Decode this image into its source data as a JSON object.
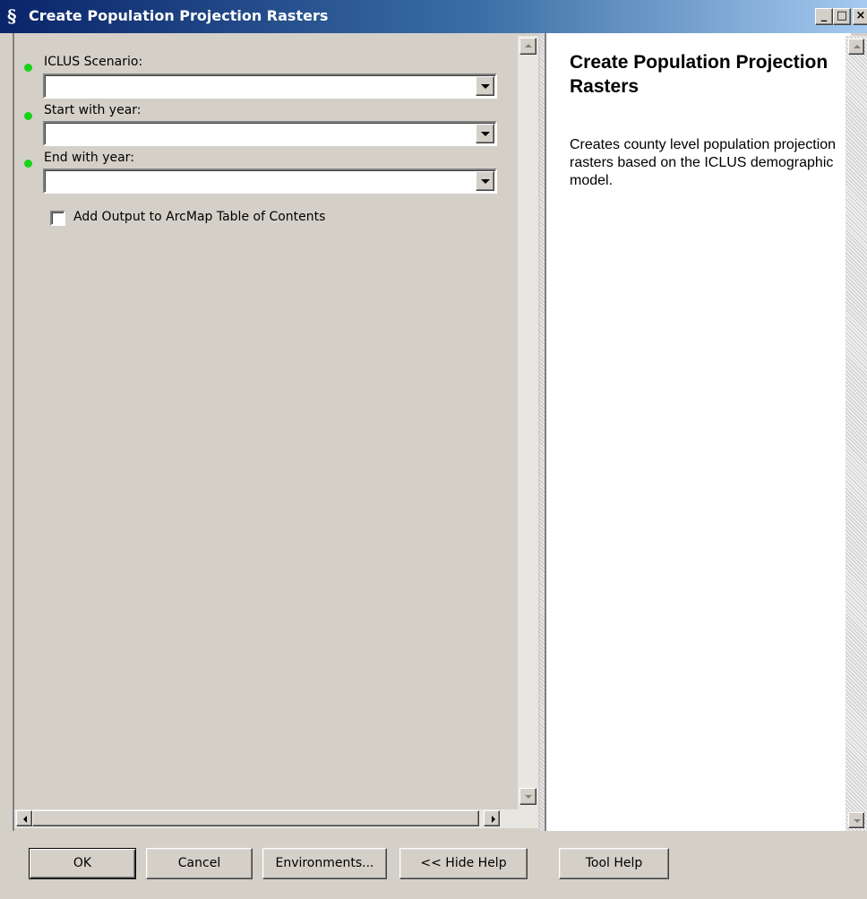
{
  "window": {
    "title": "Create Population Projection Rasters",
    "title_icon": "script-icon",
    "min_label": "_",
    "max_label": "□",
    "close_label": "×"
  },
  "parameters": [
    {
      "label": "ICLUS Scenario:",
      "required": true,
      "value": ""
    },
    {
      "label": "Start with year:",
      "required": true,
      "value": ""
    },
    {
      "label": "End with year:",
      "required": true,
      "value": ""
    }
  ],
  "options": {
    "add_output_label": "Add Output to ArcMap Table of Contents",
    "add_output_checked": false
  },
  "help": {
    "title": "Create Population Projection Rasters",
    "body": "Creates county level population projection rasters based on the ICLUS demographic model."
  },
  "buttons": {
    "ok": "OK",
    "cancel": "Cancel",
    "environments": "Environments...",
    "hide_help": "<< Hide Help",
    "tool_help": "Tool Help"
  },
  "colors": {
    "title_bar_start": "#0a246a",
    "title_bar_end": "#a6caf0",
    "face": "#d4d0c8",
    "required_dot": "#19d219"
  }
}
